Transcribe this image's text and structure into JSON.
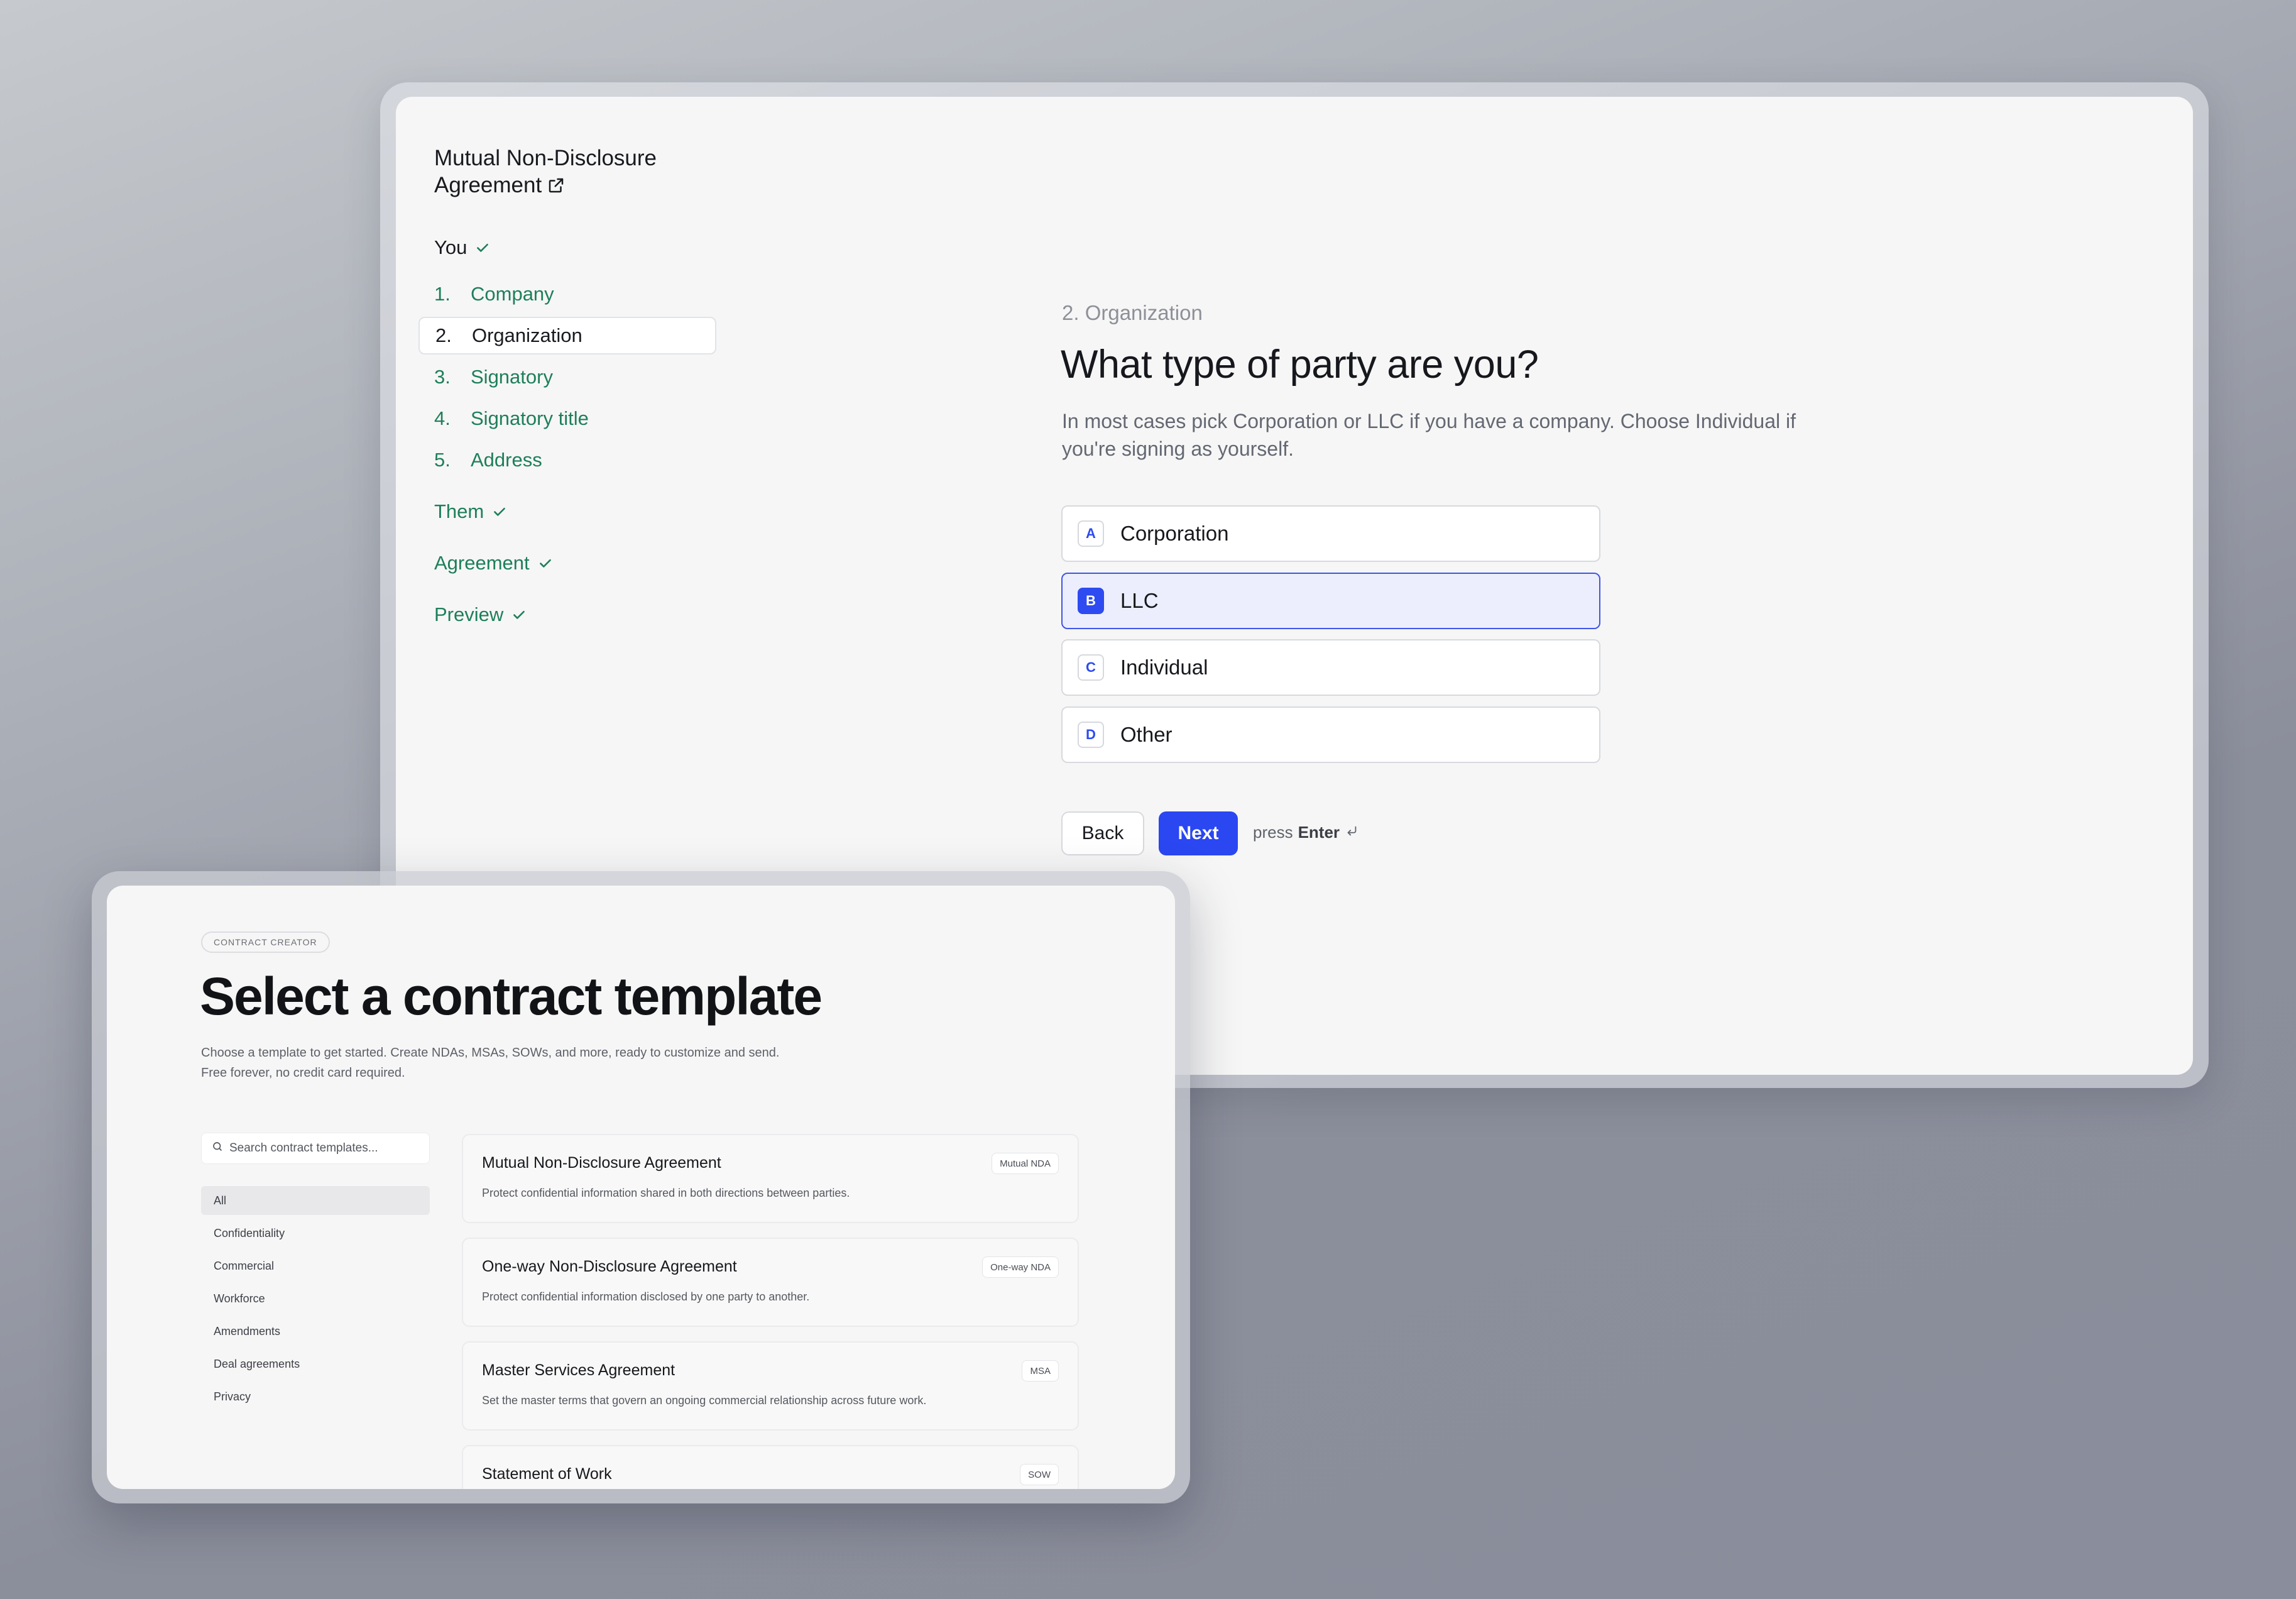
{
  "wizard": {
    "doc_title": "Mutual Non-Disclosure Agreement",
    "external_link_icon": "external-link-icon",
    "sections": {
      "you": "You",
      "them": "Them",
      "agreement": "Agreement",
      "preview": "Preview"
    },
    "steps": [
      {
        "num": "1.",
        "label": "Company"
      },
      {
        "num": "2.",
        "label": "Organization"
      },
      {
        "num": "3.",
        "label": "Signatory"
      },
      {
        "num": "4.",
        "label": "Signatory title"
      },
      {
        "num": "5.",
        "label": "Address"
      }
    ],
    "active_step": 2,
    "crumb": "2. Organization",
    "question": "What type of party are you?",
    "hint": "In most cases pick Corporation or LLC if you have a company. Choose Individual if you're signing as yourself.",
    "options": [
      {
        "key": "A",
        "label": "Corporation"
      },
      {
        "key": "B",
        "label": "LLC"
      },
      {
        "key": "C",
        "label": "Individual"
      },
      {
        "key": "D",
        "label": "Other"
      }
    ],
    "selected_option": "B",
    "back_label": "Back",
    "next_label": "Next",
    "enter_prefix": "press",
    "enter_key": "Enter",
    "colors": {
      "accent": "#2a47f2",
      "green": "#1e7f5a",
      "selected_bg": "#eceefd"
    }
  },
  "templates": {
    "pill": "CONTRACT CREATOR",
    "title": "Select a contract template",
    "subtitle": "Choose a template to get started. Create NDAs, MSAs, SOWs, and more, ready to customize and send. Free forever, no credit card required.",
    "search_placeholder": "Search contract templates...",
    "categories": [
      "All",
      "Confidentiality",
      "Commercial",
      "Workforce",
      "Amendments",
      "Deal agreements",
      "Privacy"
    ],
    "active_category": "All",
    "cards": [
      {
        "title": "Mutual Non-Disclosure Agreement",
        "desc": "Protect confidential information shared in both directions between parties.",
        "tag": "Mutual NDA"
      },
      {
        "title": "One-way Non-Disclosure Agreement",
        "desc": "Protect confidential information disclosed by one party to another.",
        "tag": "One-way NDA"
      },
      {
        "title": "Master Services Agreement",
        "desc": "Set the master terms that govern an ongoing commercial relationship across future work.",
        "tag": "MSA"
      },
      {
        "title": "Statement of Work",
        "desc": "",
        "tag": "SOW"
      }
    ]
  }
}
